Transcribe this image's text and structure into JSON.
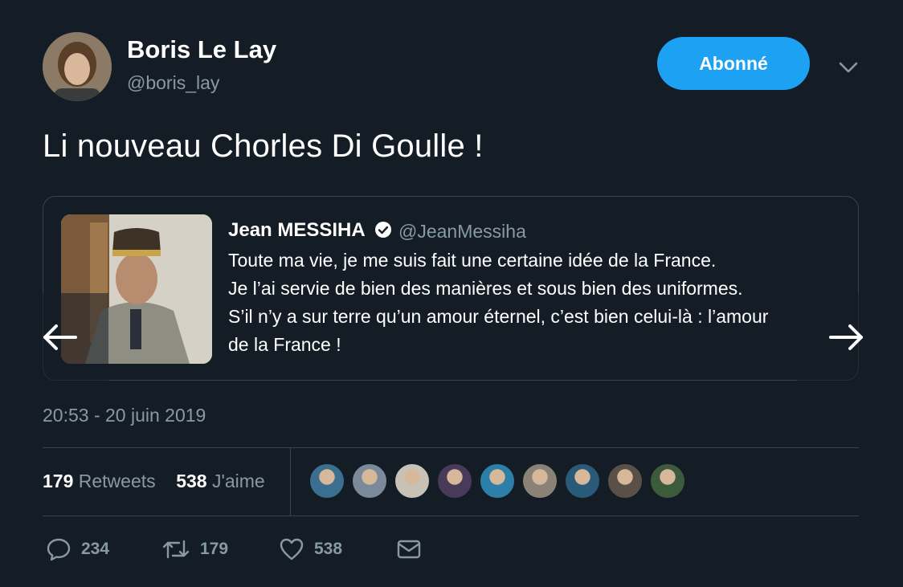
{
  "tweet": {
    "author": {
      "name": "Boris Le Lay",
      "handle": "@boris_lay"
    },
    "follow_label": "Abonné",
    "text": "Li nouveau Chorles Di Goulle !",
    "timestamp": "20:53 - 20 juin 2019"
  },
  "quoted_tweet": {
    "author": {
      "name": "Jean MESSIHA",
      "handle": "@JeanMessiha",
      "verified": true
    },
    "lines": [
      "Toute ma vie, je me suis fait une certaine idée de la France.",
      "Je l’ai servie de bien des manières et sous bien des uniformes.",
      "S’il n’y a sur terre qu’un amour éternel, c’est bien celui-là : l’amour",
      "de la France !"
    ]
  },
  "stats": {
    "retweets_count": "179",
    "retweets_label": "Retweets",
    "likes_count": "538",
    "likes_label": "J'aime"
  },
  "actions": {
    "replies": "234",
    "retweets": "179",
    "likes": "538"
  },
  "liker_avatar_colors": [
    "#3a6f8f",
    "#7a8a9a",
    "#c8c2b6",
    "#4a3a5a",
    "#2c7fa8",
    "#8a8276",
    "#2a5a7a",
    "#5a5048",
    "#3c5a3c"
  ],
  "colors": {
    "background": "#141d26",
    "accent": "#1da1f2",
    "muted": "#8899a6",
    "border": "#38444d"
  }
}
